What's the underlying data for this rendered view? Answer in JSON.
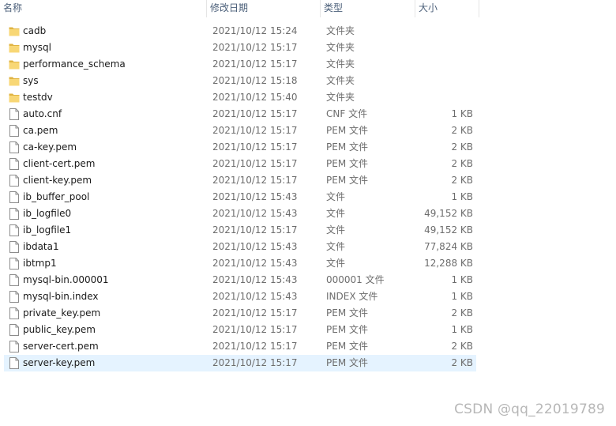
{
  "header": {
    "name": "名称",
    "date": "修改日期",
    "type": "类型",
    "size": "大小"
  },
  "files": [
    {
      "name": "cadb",
      "date": "2021/10/12 15:24",
      "type": "文件夹",
      "size": "",
      "icon": "folder-icon"
    },
    {
      "name": "mysql",
      "date": "2021/10/12 15:17",
      "type": "文件夹",
      "size": "",
      "icon": "folder-icon"
    },
    {
      "name": "performance_schema",
      "date": "2021/10/12 15:17",
      "type": "文件夹",
      "size": "",
      "icon": "folder-icon"
    },
    {
      "name": "sys",
      "date": "2021/10/12 15:18",
      "type": "文件夹",
      "size": "",
      "icon": "folder-icon"
    },
    {
      "name": "testdv",
      "date": "2021/10/12 15:40",
      "type": "文件夹",
      "size": "",
      "icon": "folder-icon"
    },
    {
      "name": "auto.cnf",
      "date": "2021/10/12 15:17",
      "type": "CNF 文件",
      "size": "1 KB",
      "icon": "file-icon"
    },
    {
      "name": "ca.pem",
      "date": "2021/10/12 15:17",
      "type": "PEM 文件",
      "size": "2 KB",
      "icon": "file-icon"
    },
    {
      "name": "ca-key.pem",
      "date": "2021/10/12 15:17",
      "type": "PEM 文件",
      "size": "2 KB",
      "icon": "file-icon"
    },
    {
      "name": "client-cert.pem",
      "date": "2021/10/12 15:17",
      "type": "PEM 文件",
      "size": "2 KB",
      "icon": "file-icon"
    },
    {
      "name": "client-key.pem",
      "date": "2021/10/12 15:17",
      "type": "PEM 文件",
      "size": "2 KB",
      "icon": "file-icon"
    },
    {
      "name": "ib_buffer_pool",
      "date": "2021/10/12 15:43",
      "type": "文件",
      "size": "1 KB",
      "icon": "file-icon"
    },
    {
      "name": "ib_logfile0",
      "date": "2021/10/12 15:43",
      "type": "文件",
      "size": "49,152 KB",
      "icon": "file-icon"
    },
    {
      "name": "ib_logfile1",
      "date": "2021/10/12 15:17",
      "type": "文件",
      "size": "49,152 KB",
      "icon": "file-icon"
    },
    {
      "name": "ibdata1",
      "date": "2021/10/12 15:43",
      "type": "文件",
      "size": "77,824 KB",
      "icon": "file-icon"
    },
    {
      "name": "ibtmp1",
      "date": "2021/10/12 15:43",
      "type": "文件",
      "size": "12,288 KB",
      "icon": "file-icon"
    },
    {
      "name": "mysql-bin.000001",
      "date": "2021/10/12 15:43",
      "type": "000001 文件",
      "size": "1 KB",
      "icon": "file-icon"
    },
    {
      "name": "mysql-bin.index",
      "date": "2021/10/12 15:43",
      "type": "INDEX 文件",
      "size": "1 KB",
      "icon": "file-icon"
    },
    {
      "name": "private_key.pem",
      "date": "2021/10/12 15:17",
      "type": "PEM 文件",
      "size": "2 KB",
      "icon": "file-icon"
    },
    {
      "name": "public_key.pem",
      "date": "2021/10/12 15:17",
      "type": "PEM 文件",
      "size": "1 KB",
      "icon": "file-icon"
    },
    {
      "name": "server-cert.pem",
      "date": "2021/10/12 15:17",
      "type": "PEM 文件",
      "size": "2 KB",
      "icon": "file-icon"
    },
    {
      "name": "server-key.pem",
      "date": "2021/10/12 15:17",
      "type": "PEM 文件",
      "size": "2 KB",
      "icon": "file-icon",
      "selected": true
    }
  ],
  "colors": {
    "folder": "#f8d775",
    "folder_dark": "#e0b443",
    "selected_row": "#e5f3ff",
    "header_text": "#4c607a"
  },
  "watermark": "CSDN @qq_22019789"
}
